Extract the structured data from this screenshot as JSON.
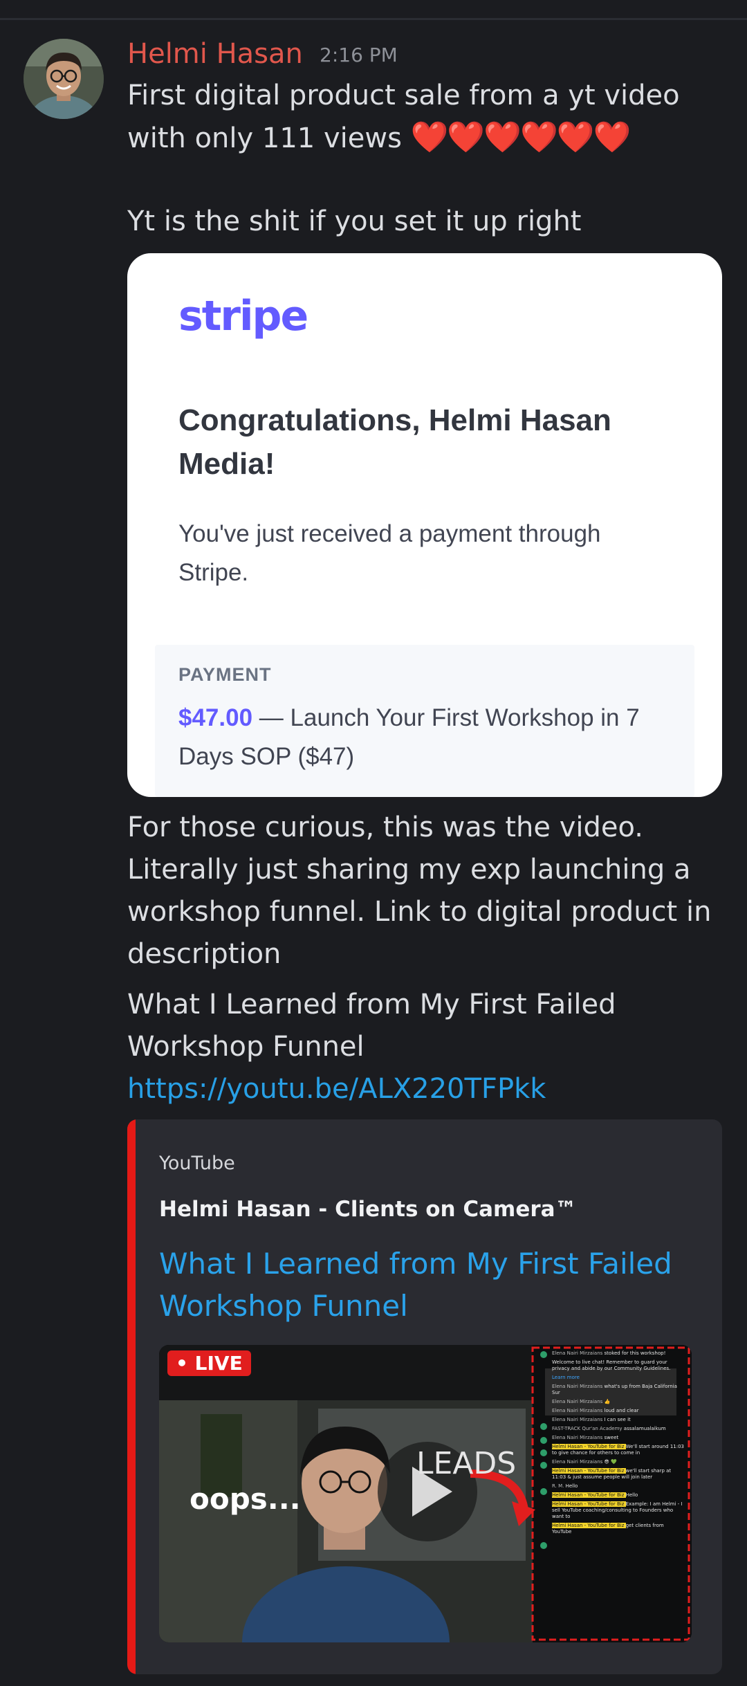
{
  "message": {
    "author": "Helmi Hasan",
    "timestamp": "2:16 PM",
    "line1": "First digital product sale from a yt video",
    "line2": "with only 111 views",
    "hearts": "❤️❤️❤️❤️❤️❤️",
    "line3": "Yt is the shit if you set it up right",
    "para1": [
      "For those curious, this was the video.",
      "Literally just sharing my exp launching a",
      "workshop funnel. Link to digital product in",
      "description"
    ],
    "para2": [
      "What I Learned from My First Failed",
      "Workshop Funnel"
    ],
    "url": "https://youtu.be/ALX220TFPkk"
  },
  "stripe_card": {
    "logo": "stripe",
    "title": "Congratulations, Helmi Hasan Media!",
    "body": "You've just received a payment through Stripe.",
    "payment_label": "PAYMENT",
    "amount": "$47.00",
    "detail": " — Launch Your First Workshop in 7 Days SOP ($47)"
  },
  "youtube_embed": {
    "provider": "YouTube",
    "author": "Helmi Hasan - Clients on Camera™",
    "title": "What I Learned from My First Failed Workshop Funnel",
    "thumbnail": {
      "live_badge": "• LIVE",
      "overlay_left": "oops...",
      "overlay_right": "LEADS",
      "chat": [
        {
          "name": "Elena Nairi Mirzaians",
          "text": "stoked for this workshop!"
        },
        {
          "name": "",
          "text": "Welcome to live chat! Remember to guard your privacy and abide by our Community Guidelines."
        },
        {
          "name": "",
          "text": "Learn more"
        },
        {
          "name": "Elena Nairi Mirzaians",
          "text": "what's up from Baja California Sur"
        },
        {
          "name": "Elena Nairi Mirzaians",
          "text": "👍"
        },
        {
          "name": "Elena Nairi Mirzaians",
          "text": "loud and clear"
        },
        {
          "name": "Elena Nairi Mirzaians",
          "text": "I can see it"
        },
        {
          "name": "FAST-TRACK Qur'an Academy",
          "text": "assalamualaikum"
        },
        {
          "name": "Elena Nairi Mirzaians",
          "text": "sweet"
        },
        {
          "name": "Helmi Hasan - YouTube for Biz",
          "text": "We'll start around 11:03 to give chance for others to come in"
        },
        {
          "name": "Elena Nairi Mirzaians",
          "text": "😎 💚"
        },
        {
          "name": "Helmi Hasan - YouTube for Biz",
          "text": "we'll start sharp at 11:03 & just assume people will join later"
        },
        {
          "name": "R. M.",
          "text": "Hello"
        },
        {
          "name": "Helmi Hasan - YouTube for Biz",
          "text": "Hello"
        },
        {
          "name": "Helmi Hasan - YouTube for Biz",
          "text": "Example: I am Helmi - I sell YouTube coaching/consulting to Founders who want to"
        },
        {
          "name": "Helmi Hasan - YouTube for Biz",
          "text": "get clients from YouTube"
        }
      ]
    }
  },
  "colors": {
    "background": "#1b1c20",
    "username": "#e1574c",
    "link": "#28a0e6",
    "stripe_accent": "#635bff",
    "youtube_red": "#e51a16"
  }
}
